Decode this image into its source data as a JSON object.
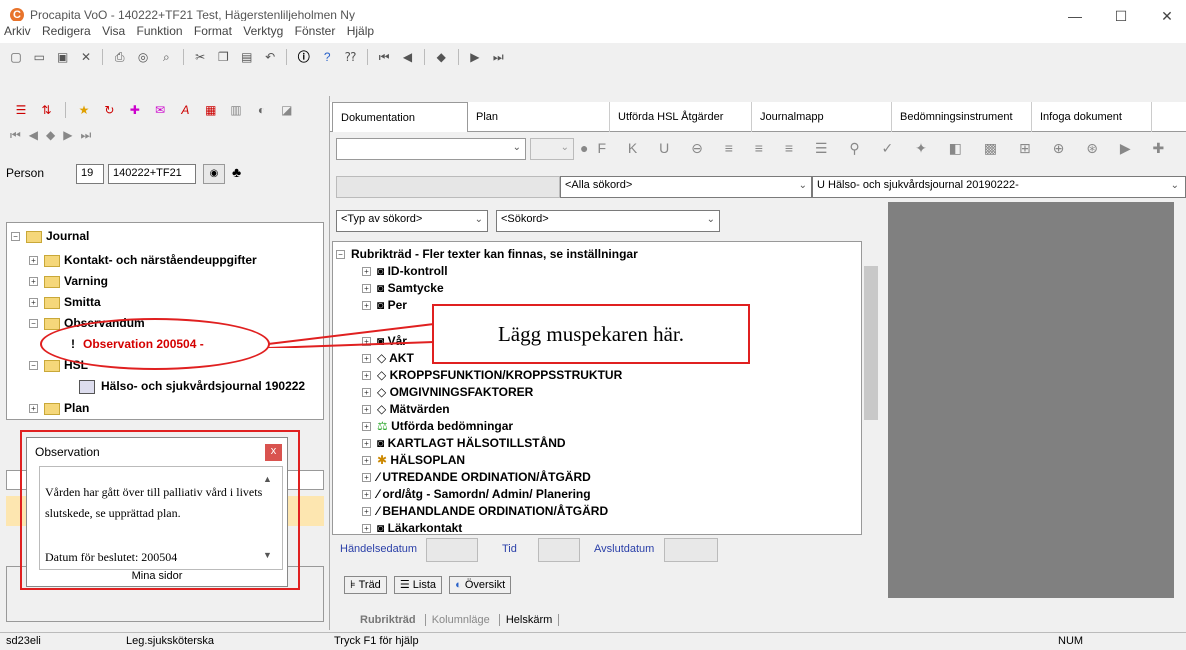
{
  "window": {
    "title": "Procapita VoO - 140222+TF21 Test, Hägerstenliljeholmen Ny",
    "logo_letter": "C",
    "min": "—",
    "max": "☐",
    "close": "✕"
  },
  "menu": [
    "Arkiv",
    "Redigera",
    "Visa",
    "Funktion",
    "Format",
    "Verktyg",
    "Fönster",
    "Hjälp"
  ],
  "person": {
    "label": "Person",
    "number": "19",
    "id": "140222+TF21"
  },
  "left_tree": {
    "root": "Journal",
    "items": [
      {
        "label": "Kontakt- och närståendeuppgifter"
      },
      {
        "label": "Varning"
      },
      {
        "label": "Smitta"
      },
      {
        "label": "Observandum"
      },
      {
        "label": "Observation 200504 -"
      },
      {
        "label": "HSL"
      },
      {
        "label": "Hälso- och sjukvårdsjournal 190222"
      },
      {
        "label": "Plan"
      }
    ]
  },
  "popup": {
    "title": "Observation",
    "close": "x",
    "text": "Vården har gått över till palliativ vård i livets slutskede, se upprättad plan.",
    "date_line": "Datum för beslutet: 200504",
    "footer": "Mina sidor"
  },
  "tabs": [
    "Dokumentation",
    "Plan",
    "Utförda HSL Åtgärder",
    "Journalmapp",
    "Bedömningsinstrument",
    "Infoga dokument"
  ],
  "filters": {
    "keyword_combo": "<Alla sökord>",
    "journal_combo": "U Hälso- och sjukvårdsjournal 20190222-",
    "type_combo": "<Typ av sökord>",
    "sokord_combo": "<Sökord>"
  },
  "mid_tree": {
    "header": "Rubrikträd - Fler texter kan finnas, se inställningar",
    "rows": [
      "ID-kontroll",
      "Samtycke",
      "Per",
      "Vår",
      "AKT",
      "KROPPSFUNKTION/KROPPSSTRUKTUR",
      "OMGIVNINGSFAKTORER",
      "Mätvärden",
      "Utförda bedömningar",
      "KARTLAGT HÄLSOTILLSTÅND",
      "HÄLSOPLAN",
      "UTREDANDE ORDINATION/ÅTGÄRD",
      "ord/åtg - Samordn/ Admin/ Planering",
      "BEHANDLANDE ORDINATION/ÅTGÄRD",
      "Läkarkontakt"
    ]
  },
  "callout": "Lägg muspekaren här.",
  "dates": {
    "event": "Händelsedatum",
    "time": "Tid",
    "end": "Avslutdatum"
  },
  "view_tabs": [
    "Träd",
    "Lista",
    "Översikt"
  ],
  "bottom_tabs": [
    "Rubrikträd",
    "Kolumnläge",
    "Helskärm"
  ],
  "status": {
    "user": "sd23eli",
    "role": "Leg.sjuksköterska",
    "help": "Tryck F1 för hjälp",
    "num": "NUM"
  },
  "colors": {
    "accent_red": "#e02020",
    "folder_yellow": "#f5d77a",
    "selected_red_text": "#d40000"
  }
}
